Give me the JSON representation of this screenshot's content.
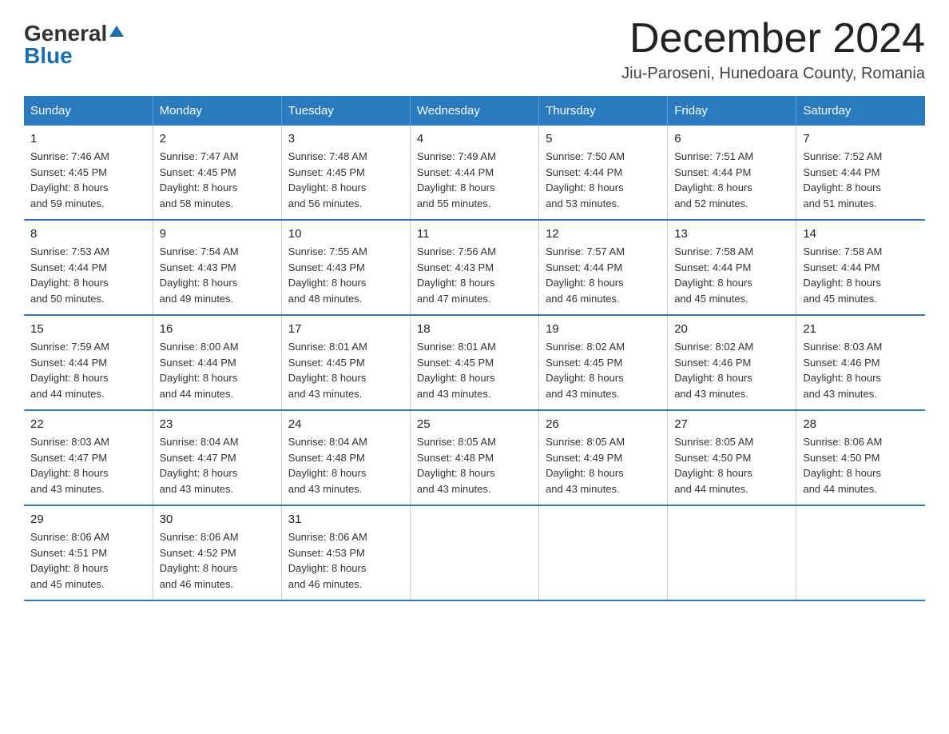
{
  "logo": {
    "line1": "General",
    "triangle": "▲",
    "line2": "Blue"
  },
  "title": "December 2024",
  "location": "Jiu-Paroseni, Hunedoara County, Romania",
  "days_of_week": [
    "Sunday",
    "Monday",
    "Tuesday",
    "Wednesday",
    "Thursday",
    "Friday",
    "Saturday"
  ],
  "weeks": [
    [
      {
        "day": "1",
        "info": "Sunrise: 7:46 AM\nSunset: 4:45 PM\nDaylight: 8 hours\nand 59 minutes."
      },
      {
        "day": "2",
        "info": "Sunrise: 7:47 AM\nSunset: 4:45 PM\nDaylight: 8 hours\nand 58 minutes."
      },
      {
        "day": "3",
        "info": "Sunrise: 7:48 AM\nSunset: 4:45 PM\nDaylight: 8 hours\nand 56 minutes."
      },
      {
        "day": "4",
        "info": "Sunrise: 7:49 AM\nSunset: 4:44 PM\nDaylight: 8 hours\nand 55 minutes."
      },
      {
        "day": "5",
        "info": "Sunrise: 7:50 AM\nSunset: 4:44 PM\nDaylight: 8 hours\nand 53 minutes."
      },
      {
        "day": "6",
        "info": "Sunrise: 7:51 AM\nSunset: 4:44 PM\nDaylight: 8 hours\nand 52 minutes."
      },
      {
        "day": "7",
        "info": "Sunrise: 7:52 AM\nSunset: 4:44 PM\nDaylight: 8 hours\nand 51 minutes."
      }
    ],
    [
      {
        "day": "8",
        "info": "Sunrise: 7:53 AM\nSunset: 4:44 PM\nDaylight: 8 hours\nand 50 minutes."
      },
      {
        "day": "9",
        "info": "Sunrise: 7:54 AM\nSunset: 4:43 PM\nDaylight: 8 hours\nand 49 minutes."
      },
      {
        "day": "10",
        "info": "Sunrise: 7:55 AM\nSunset: 4:43 PM\nDaylight: 8 hours\nand 48 minutes."
      },
      {
        "day": "11",
        "info": "Sunrise: 7:56 AM\nSunset: 4:43 PM\nDaylight: 8 hours\nand 47 minutes."
      },
      {
        "day": "12",
        "info": "Sunrise: 7:57 AM\nSunset: 4:44 PM\nDaylight: 8 hours\nand 46 minutes."
      },
      {
        "day": "13",
        "info": "Sunrise: 7:58 AM\nSunset: 4:44 PM\nDaylight: 8 hours\nand 45 minutes."
      },
      {
        "day": "14",
        "info": "Sunrise: 7:58 AM\nSunset: 4:44 PM\nDaylight: 8 hours\nand 45 minutes."
      }
    ],
    [
      {
        "day": "15",
        "info": "Sunrise: 7:59 AM\nSunset: 4:44 PM\nDaylight: 8 hours\nand 44 minutes."
      },
      {
        "day": "16",
        "info": "Sunrise: 8:00 AM\nSunset: 4:44 PM\nDaylight: 8 hours\nand 44 minutes."
      },
      {
        "day": "17",
        "info": "Sunrise: 8:01 AM\nSunset: 4:45 PM\nDaylight: 8 hours\nand 43 minutes."
      },
      {
        "day": "18",
        "info": "Sunrise: 8:01 AM\nSunset: 4:45 PM\nDaylight: 8 hours\nand 43 minutes."
      },
      {
        "day": "19",
        "info": "Sunrise: 8:02 AM\nSunset: 4:45 PM\nDaylight: 8 hours\nand 43 minutes."
      },
      {
        "day": "20",
        "info": "Sunrise: 8:02 AM\nSunset: 4:46 PM\nDaylight: 8 hours\nand 43 minutes."
      },
      {
        "day": "21",
        "info": "Sunrise: 8:03 AM\nSunset: 4:46 PM\nDaylight: 8 hours\nand 43 minutes."
      }
    ],
    [
      {
        "day": "22",
        "info": "Sunrise: 8:03 AM\nSunset: 4:47 PM\nDaylight: 8 hours\nand 43 minutes."
      },
      {
        "day": "23",
        "info": "Sunrise: 8:04 AM\nSunset: 4:47 PM\nDaylight: 8 hours\nand 43 minutes."
      },
      {
        "day": "24",
        "info": "Sunrise: 8:04 AM\nSunset: 4:48 PM\nDaylight: 8 hours\nand 43 minutes."
      },
      {
        "day": "25",
        "info": "Sunrise: 8:05 AM\nSunset: 4:48 PM\nDaylight: 8 hours\nand 43 minutes."
      },
      {
        "day": "26",
        "info": "Sunrise: 8:05 AM\nSunset: 4:49 PM\nDaylight: 8 hours\nand 43 minutes."
      },
      {
        "day": "27",
        "info": "Sunrise: 8:05 AM\nSunset: 4:50 PM\nDaylight: 8 hours\nand 44 minutes."
      },
      {
        "day": "28",
        "info": "Sunrise: 8:06 AM\nSunset: 4:50 PM\nDaylight: 8 hours\nand 44 minutes."
      }
    ],
    [
      {
        "day": "29",
        "info": "Sunrise: 8:06 AM\nSunset: 4:51 PM\nDaylight: 8 hours\nand 45 minutes."
      },
      {
        "day": "30",
        "info": "Sunrise: 8:06 AM\nSunset: 4:52 PM\nDaylight: 8 hours\nand 46 minutes."
      },
      {
        "day": "31",
        "info": "Sunrise: 8:06 AM\nSunset: 4:53 PM\nDaylight: 8 hours\nand 46 minutes."
      },
      {
        "day": "",
        "info": ""
      },
      {
        "day": "",
        "info": ""
      },
      {
        "day": "",
        "info": ""
      },
      {
        "day": "",
        "info": ""
      }
    ]
  ]
}
